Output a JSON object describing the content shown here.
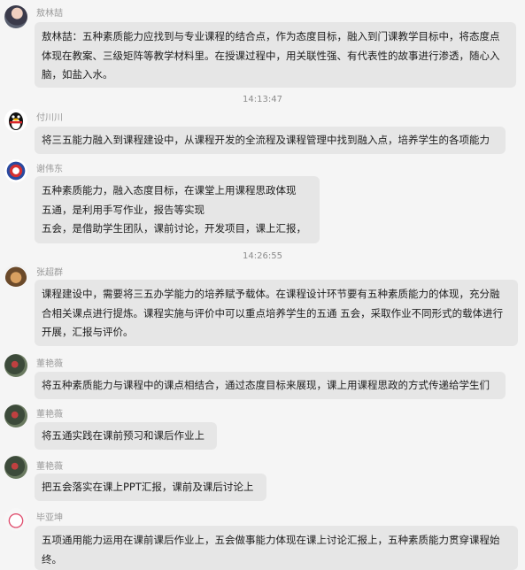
{
  "messages": [
    {
      "sender": "敖林喆",
      "lines": [
        "敖林喆：五种素质能力应找到与专业课程的结合点，作为态度目标，融入到门课教学目标中，将态度点",
        "体现在教案、三级矩阵等教学材料里。在授课过程中，用关联性强、有代表性的故事进行渗透，随心入",
        "脑，如盐入水。"
      ]
    },
    {
      "sender": "付川川",
      "lines": [
        "将三五能力融入到课程建设中，从课程开发的全流程及课程管理中找到融入点，培养学生的各项能力"
      ]
    },
    {
      "sender": "谢伟东",
      "lines": [
        "五种素质能力，融入态度目标，在课堂上用课程思政体现",
        "五通，是利用手写作业，报告等实现",
        "五会，是借助学生团队，课前讨论，开发项目，课上汇报，"
      ]
    },
    {
      "sender": "张超群",
      "lines": [
        "课程建设中，需要将三五办学能力的培养赋予载体。在课程设计环节要有五种素质能力的体现，充分融",
        "合相关课点进行提炼。课程实施与评价中可以重点培养学生的五通 五会，采取作业不同形式的载体进行",
        "开展，汇报与评价。"
      ]
    },
    {
      "sender": "董艳薇",
      "lines": [
        "将五种素质能力与课程中的课点相结合，通过态度目标来展现，课上用课程思政的方式传递给学生们"
      ]
    },
    {
      "sender": "董艳薇",
      "lines": [
        "将五通实践在课前预习和课后作业上"
      ]
    },
    {
      "sender": "董艳薇",
      "lines": [
        "把五会落实在课上PPT汇报，课前及课后讨论上"
      ]
    },
    {
      "sender": "毕亚坤",
      "lines": [
        "五项通用能力运用在课前课后作业上，五会做事能力体现在课上讨论汇报上，五种素质能力贯穿课程始",
        "终。"
      ]
    }
  ],
  "timestamps": [
    "14:13:47",
    "14:26:55"
  ],
  "avatar_icons": [
    "girl-avatar-icon",
    "qq-penguin-avatar-icon",
    "opera-mask-avatar-icon",
    "hedgehog-avatar-icon",
    "rose-avatar-icon",
    "rose-avatar-icon",
    "rose-avatar-icon",
    "cat-avatar-icon"
  ],
  "colors": {
    "background": "#f5f5f5",
    "bubble": "#e6e6e6",
    "name": "#999999",
    "timestamp": "#8c8c8c"
  }
}
